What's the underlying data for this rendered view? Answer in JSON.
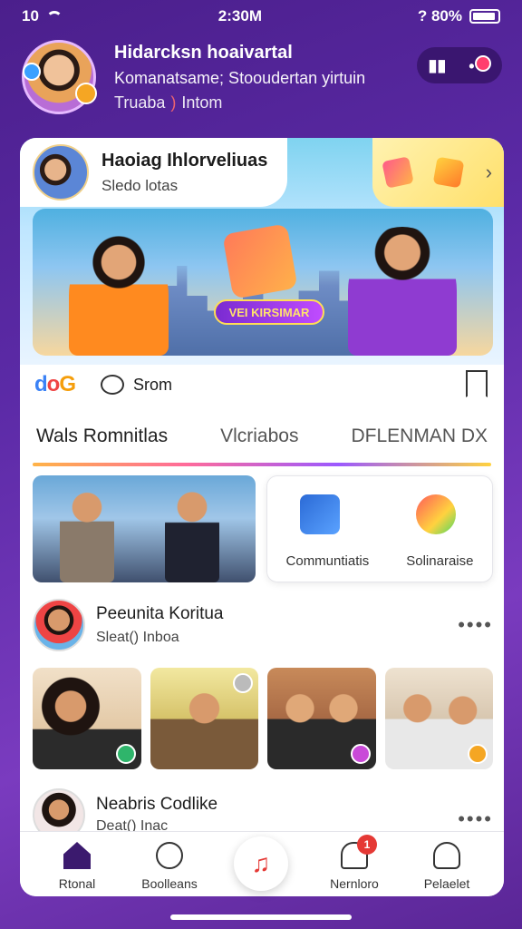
{
  "status": {
    "time": "2:30M",
    "left": "10",
    "battery": "? 80%",
    "battery_level": 0.8
  },
  "header": {
    "title": "Hidarcksn hoaivartal",
    "subtitle": "Komanatsame; Stooudertan yirtuin",
    "meta_left": "Truaba",
    "meta_sep": ")",
    "meta_right": "Intom",
    "pill_icon": "phone-icon",
    "pill_dot": "notification-dot"
  },
  "feature": {
    "name": "Haoiag Ihlorveliuas",
    "sub": "Sledo lotas",
    "hero_label": "VEI KIRSIMAR",
    "logo": {
      "d": "d",
      "o": "o",
      "g": "G"
    },
    "comment_label": "Srom"
  },
  "tabs": [
    "Wals Romnitlas",
    "Vlcriabos",
    "DFLENMAN DX"
  ],
  "tiles": {
    "left_label": "Communtiatis",
    "right_label": "Solinaraise"
  },
  "post1": {
    "name": "Peeunita Koritua",
    "sub": "Sleat() Inboa",
    "more": "••••"
  },
  "post2": {
    "name": "Neabris Codlike",
    "sub": "Deat() Inac",
    "more": "••••"
  },
  "nav": {
    "items": [
      {
        "label": "Rtonal",
        "icon": "home-icon"
      },
      {
        "label": "Boolleans",
        "icon": "compass-icon"
      },
      {
        "label": "Nernloro",
        "icon": "bell-icon",
        "badge": "1"
      },
      {
        "label": "Pelaelet",
        "icon": "user-icon"
      }
    ],
    "center_icon": "music-note-icon"
  }
}
